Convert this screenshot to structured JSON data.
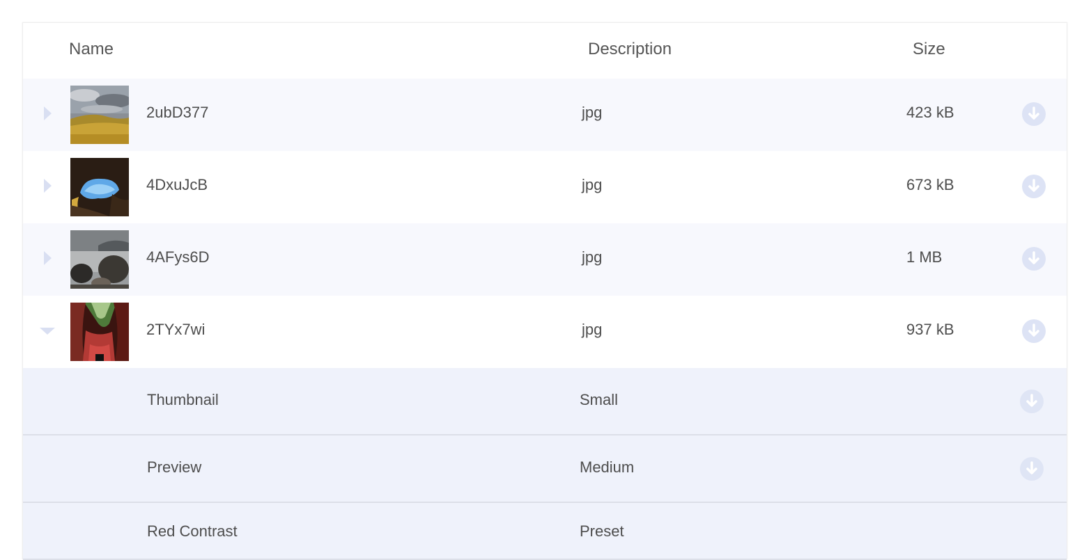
{
  "table": {
    "headers": {
      "name": "Name",
      "description": "Description",
      "size": "Size"
    },
    "rows": [
      {
        "name": "2ubD377",
        "description": "jpg",
        "size": "423 kB",
        "expanded": false,
        "thumbnail": "grassland-sky"
      },
      {
        "name": "4DxuJcB",
        "description": "jpg",
        "size": "673 kB",
        "expanded": false,
        "thumbnail": "cave-sky"
      },
      {
        "name": "4AFys6D",
        "description": "jpg",
        "size": "1 MB",
        "expanded": false,
        "thumbnail": "misty-rocks"
      },
      {
        "name": "2TYx7wi",
        "description": "jpg",
        "size": "937 kB",
        "expanded": true,
        "thumbnail": "red-canyon"
      }
    ],
    "sub_rows": [
      {
        "name": "Thumbnail",
        "description": "Small",
        "downloadable": true
      },
      {
        "name": "Preview",
        "description": "Medium",
        "downloadable": true
      },
      {
        "name": "Red Contrast",
        "description": "Preset",
        "downloadable": false
      }
    ]
  },
  "icons": {
    "expand": "caret-right-icon",
    "collapse": "caret-down-icon",
    "download": "download-arrow-circle-icon"
  },
  "colors": {
    "row_alt": "#f7f8fd",
    "sub_row": "#eff2fb",
    "icon": "#d9dff2",
    "text": "#4d4d4d"
  }
}
